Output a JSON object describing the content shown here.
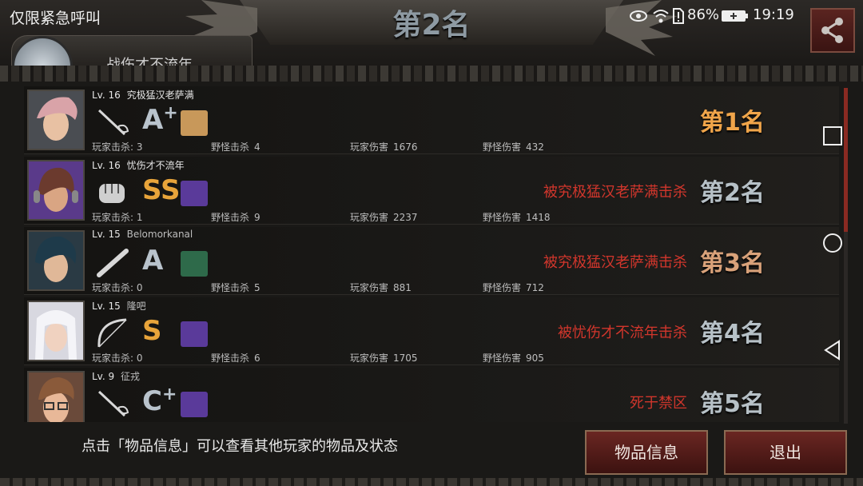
{
  "header": {
    "title": "第2名",
    "sos_label": "仅限紧急呼叫",
    "battery_percent": "86%",
    "clock": "19:19",
    "partial_player_name": "战伤才不流年"
  },
  "players": [
    {
      "level": "Lv. 16",
      "name": "究极猛汉老萨满",
      "weapon": "rapier-icon",
      "grade": "A",
      "grade_plus": "+",
      "grade_color": "#b9c3cc",
      "item": "bread-box-icon",
      "item_color": "#c8985a",
      "kills_label": "玩家击杀:",
      "kills": "3",
      "monster_kills_label": "野怪击杀",
      "monster_kills": "4",
      "player_damage_label": "玩家伤害",
      "player_damage": "1676",
      "monster_damage_label": "野怪伤害",
      "monster_damage": "432",
      "fate": "",
      "rank": "第1名",
      "avatar_hair": "#d9a3a8",
      "avatar_skin": "#e8c1a3"
    },
    {
      "level": "Lv. 16",
      "name": "忧伤才不流年",
      "weapon": "fist-icon",
      "grade": "SS",
      "grade_plus": "",
      "grade_color": "#e8a43a",
      "item": "purple-beast-icon",
      "item_color": "#5a3a9a",
      "kills_label": "玩家击杀:",
      "kills": "1",
      "monster_kills_label": "野怪击杀",
      "monster_kills": "9",
      "player_damage_label": "玩家伤害",
      "player_damage": "2237",
      "monster_damage_label": "野怪伤害",
      "monster_damage": "1418",
      "fate": "被究极猛汉老萨满击杀",
      "rank": "第2名",
      "avatar_hair": "#6b3a2e",
      "avatar_skin": "#d9a583"
    },
    {
      "level": "Lv. 15",
      "name": "Belomorkanal",
      "weapon": "bat-icon",
      "grade": "A",
      "grade_plus": "",
      "grade_color": "#b9c3cc",
      "item": "green-beast-icon",
      "item_color": "#2e6a4a",
      "kills_label": "玩家击杀:",
      "kills": "0",
      "monster_kills_label": "野怪击杀",
      "monster_kills": "5",
      "player_damage_label": "玩家伤害",
      "player_damage": "881",
      "monster_damage_label": "野怪伤害",
      "monster_damage": "712",
      "fate": "被究极猛汉老萨满击杀",
      "rank": "第3名",
      "avatar_hair": "#1e3a4a",
      "avatar_skin": "#e0b898"
    },
    {
      "level": "Lv. 15",
      "name": "隆吧",
      "weapon": "bow-icon",
      "grade": "S",
      "grade_plus": "",
      "grade_color": "#e8a43a",
      "item": "purple-beast-icon",
      "item_color": "#5a3a9a",
      "kills_label": "玩家击杀:",
      "kills": "0",
      "monster_kills_label": "野怪击杀",
      "monster_kills": "6",
      "player_damage_label": "玩家伤害",
      "player_damage": "1705",
      "monster_damage_label": "野怪伤害",
      "monster_damage": "905",
      "fate": "被忧伤才不流年击杀",
      "rank": "第4名",
      "avatar_hair": "#e8e8ee",
      "avatar_skin": "#f0d2c0"
    },
    {
      "level": "Lv. 9",
      "name": "征戎",
      "weapon": "rapier-icon",
      "grade": "C",
      "grade_plus": "+",
      "grade_color": "#b9c3cc",
      "item": "purple-beast-icon",
      "item_color": "#5a3a9a",
      "kills_label": "",
      "kills": "",
      "monster_kills_label": "",
      "monster_kills": "",
      "player_damage_label": "",
      "player_damage": "",
      "monster_damage_label": "",
      "monster_damage": "",
      "fate": "死于禁区",
      "rank": "第5名",
      "avatar_hair": "#8a5a3a",
      "avatar_skin": "#e8b898"
    }
  ],
  "footer": {
    "hint": "点击「物品信息」可以查看其他玩家的物品及状态",
    "items_button": "物品信息",
    "exit_button": "退出"
  },
  "colors": {
    "fate_red": "#d2362c",
    "rank_gold": "#f0a54a",
    "button_red": "#6a2622"
  },
  "icons": {
    "share": "share-icon",
    "eye": "eye-icon",
    "wifi": "wifi-icon",
    "sim_alert": "sim-alert-icon",
    "battery": "battery-icon",
    "nav_square": "recent-apps-icon",
    "nav_circle": "home-icon",
    "nav_back": "back-icon"
  }
}
